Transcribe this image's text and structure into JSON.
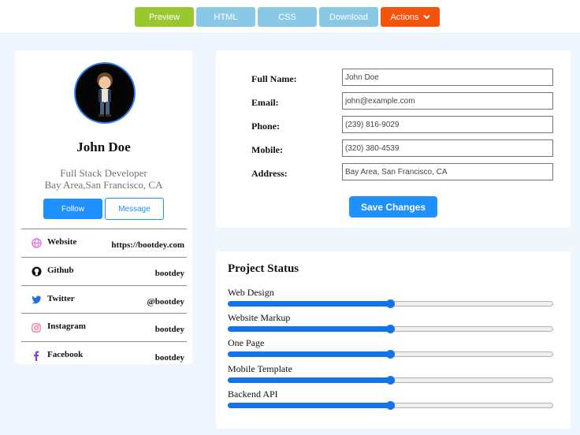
{
  "toolbar": {
    "preview": "Preview",
    "html": "HTML",
    "css": "CSS",
    "download": "Download",
    "actions": "Actions",
    "colors": {
      "preview": "#9ac730",
      "tabs": "#8ac9e6",
      "actions": "#f5520c"
    }
  },
  "profile": {
    "name": "John Doe",
    "role": "Full Stack Developer",
    "location": "Bay Area,San Francisco, CA",
    "follow_label": "Follow",
    "message_label": "Message",
    "social": [
      {
        "icon": "globe-icon",
        "label": "Website",
        "value": "https://bootdey.com",
        "color": "#e56ee5"
      },
      {
        "icon": "github-icon",
        "label": "Github",
        "value": "bootdey",
        "color": "#111111"
      },
      {
        "icon": "twitter-icon",
        "label": "Twitter",
        "value": "@bootdey",
        "color": "#1da1f2"
      },
      {
        "icon": "instagram-icon",
        "label": "Instagram",
        "value": "bootdey",
        "color": "#e1306c"
      },
      {
        "icon": "facebook-icon",
        "label": "Facebook",
        "value": "bootdey",
        "color": "#7b3fe4"
      }
    ]
  },
  "form": {
    "fields": [
      {
        "label": "Full Name:",
        "value": "John Doe"
      },
      {
        "label": "Email:",
        "value": "john@example.com"
      },
      {
        "label": "Phone:",
        "value": "(239) 816-9029"
      },
      {
        "label": "Mobile:",
        "value": "(320) 380-4539"
      },
      {
        "label": "Address:",
        "value": "Bay Area, San Francisco, CA"
      }
    ],
    "save_label": "Save Changes"
  },
  "project": {
    "title": "Project Status",
    "items": [
      {
        "label": "Web Design",
        "progress": 50
      },
      {
        "label": "Website Markup",
        "progress": 50
      },
      {
        "label": "One Page",
        "progress": 50
      },
      {
        "label": "Mobile Template",
        "progress": 50
      },
      {
        "label": "Backend API",
        "progress": 50
      }
    ]
  },
  "accent_color": "#1e90ff"
}
